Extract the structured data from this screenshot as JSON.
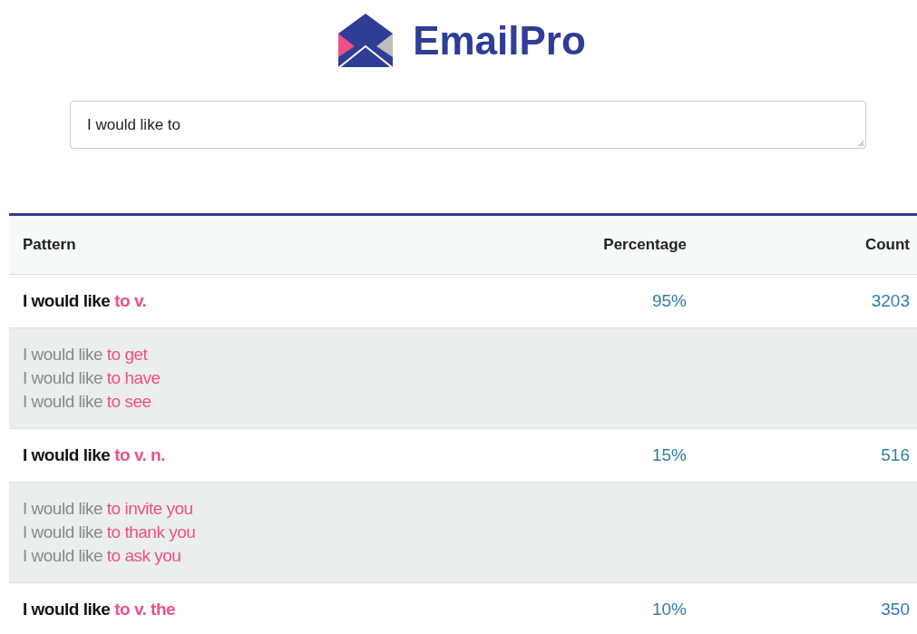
{
  "logo": {
    "name": "EmailPro"
  },
  "query": {
    "value": "I would like to"
  },
  "table": {
    "columns": [
      "Pattern",
      "Percentage",
      "Count"
    ],
    "rows": [
      {
        "prefix": "I would like",
        "highlight": "to v.",
        "percentage": "95%",
        "count": "3203",
        "examples": [
          {
            "prefix": "I would like",
            "highlight": "to get"
          },
          {
            "prefix": "I would like",
            "highlight": "to have"
          },
          {
            "prefix": "I would like",
            "highlight": "to see"
          }
        ]
      },
      {
        "prefix": "I would like",
        "highlight": "to v. n.",
        "percentage": "15%",
        "count": "516",
        "examples": [
          {
            "prefix": "I would like",
            "highlight": "to invite you"
          },
          {
            "prefix": "I would like",
            "highlight": "to thank you"
          },
          {
            "prefix": "I would like",
            "highlight": "to ask you"
          }
        ]
      },
      {
        "prefix": "I would like",
        "highlight": "to v. the",
        "percentage": "10%",
        "count": "350"
      }
    ]
  }
}
